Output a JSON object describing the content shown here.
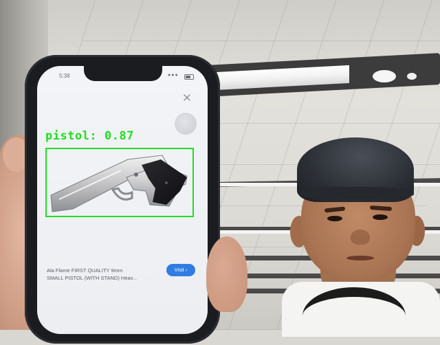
{
  "phone": {
    "status_time": "5:38",
    "status_icons": "●●●",
    "close_icon": "close-icon",
    "listing": {
      "caption_line1": "Ala Flame FIRST QUALITY 9mm",
      "caption_line2": "SMALL PISTOL (WITH STAND) Heav...",
      "visit_label": "Visit",
      "visit_arrow": "›"
    }
  },
  "detection": {
    "label": "pistol",
    "separator": ": ",
    "score": "0.87",
    "color": "#22dd22"
  }
}
